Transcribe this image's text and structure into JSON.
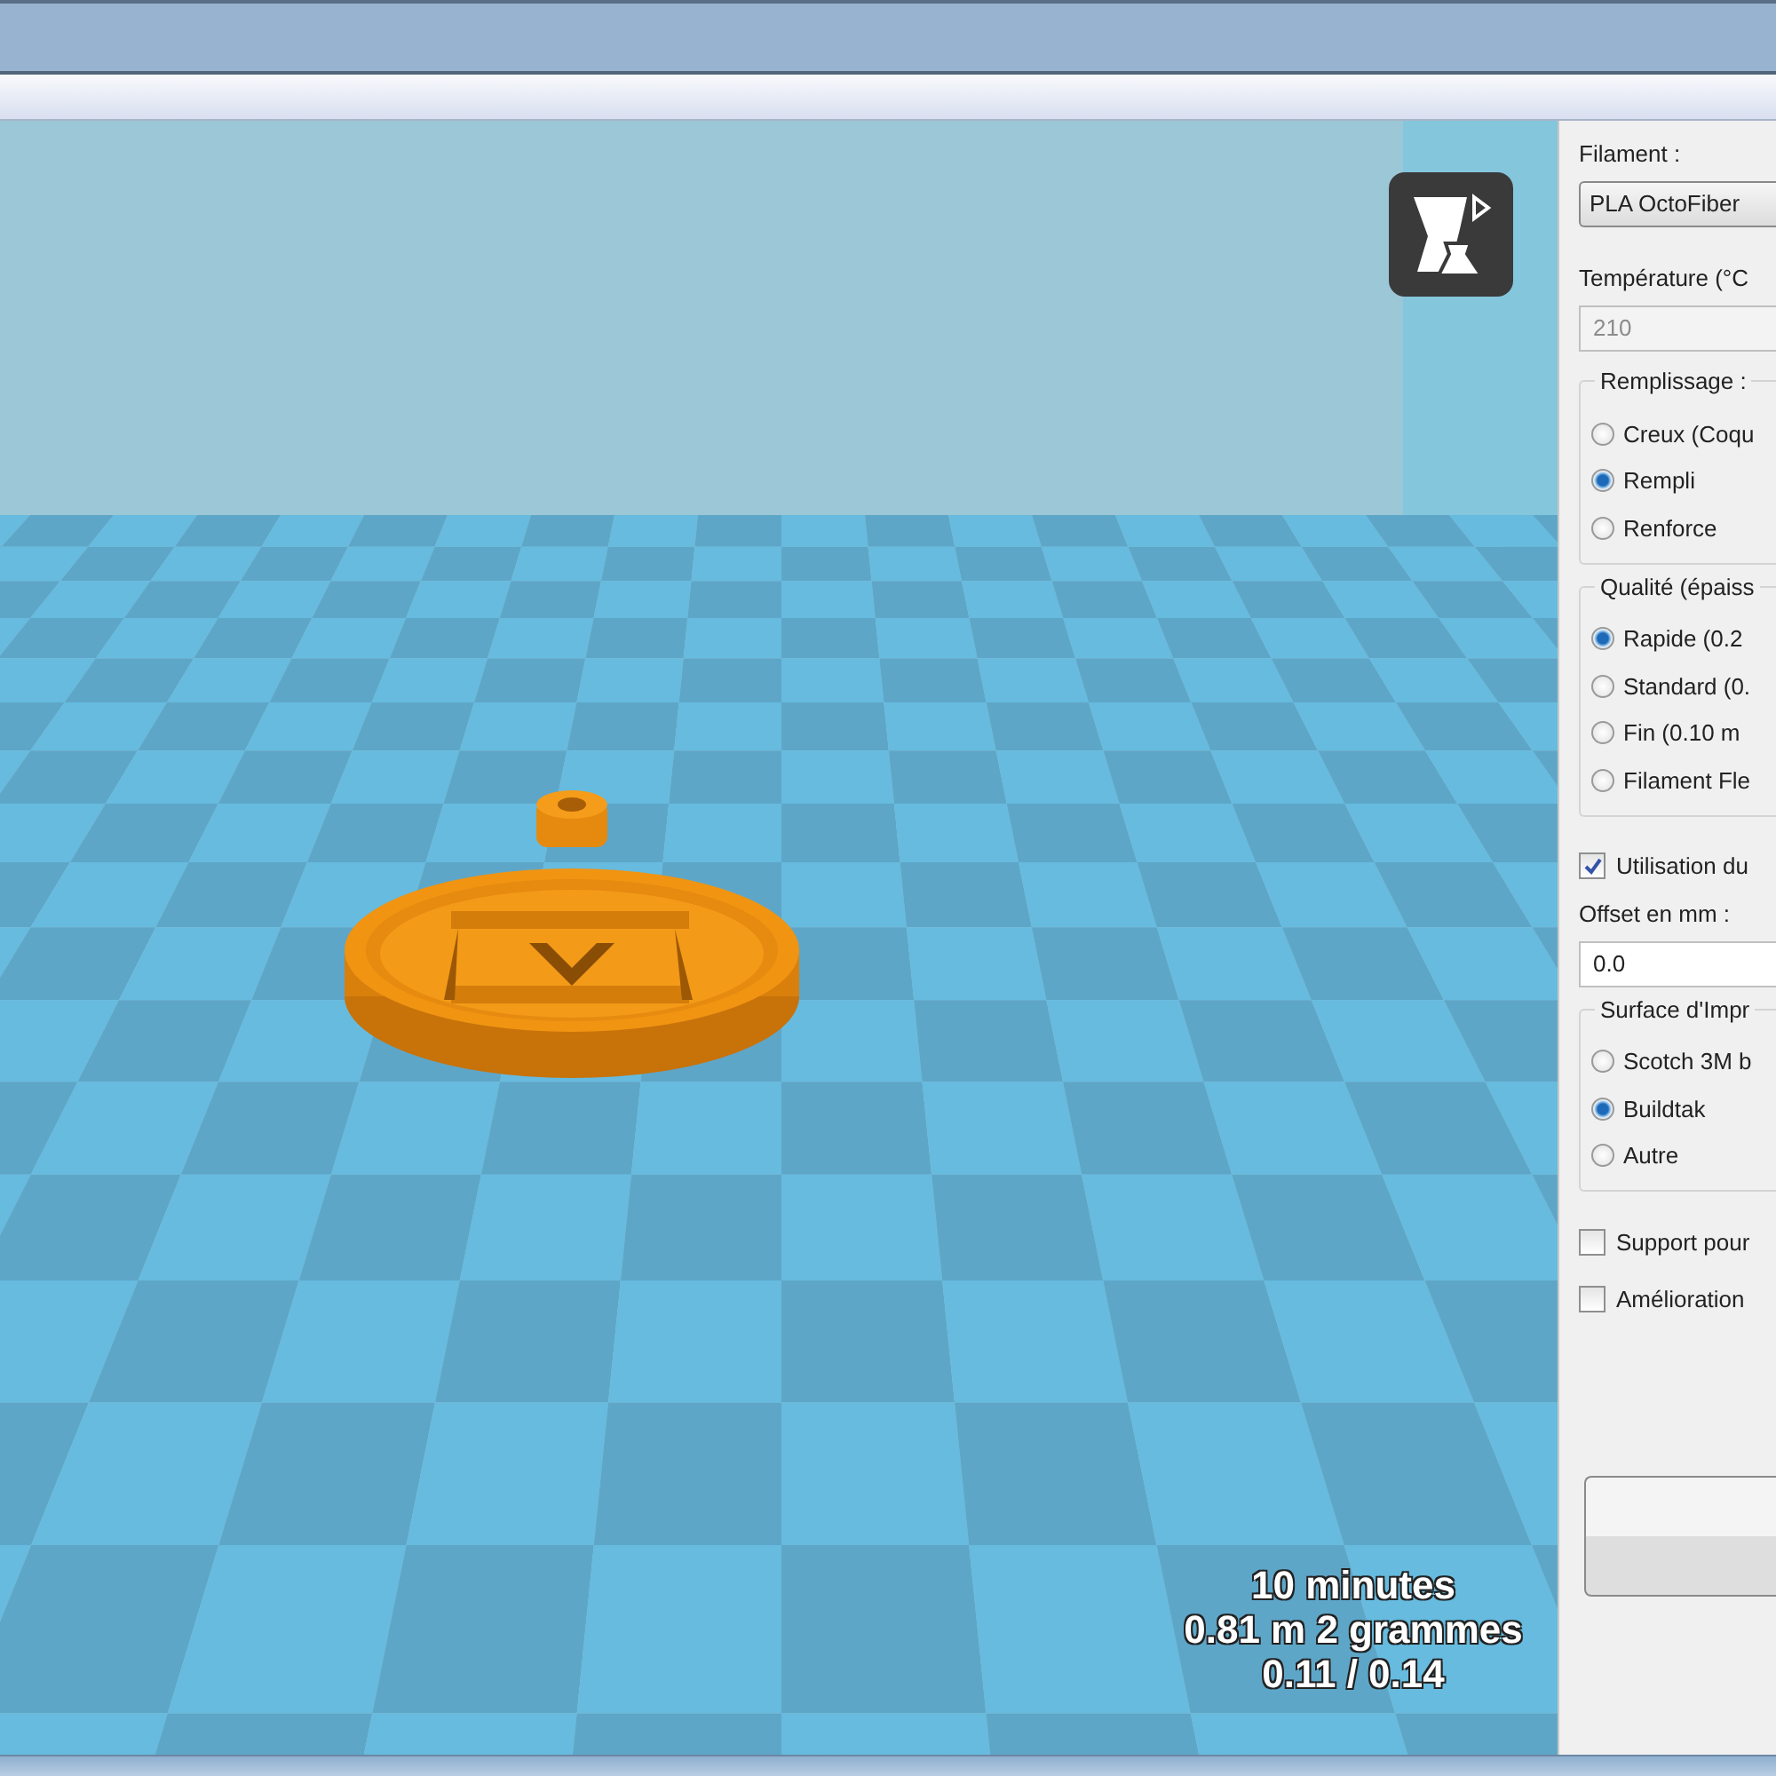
{
  "viewport": {
    "stats": [
      "10 minutes",
      "0.81 m 2 grammes",
      "0.11 / 0.14"
    ]
  },
  "panel": {
    "items": [
      {
        "kind": "label",
        "text": "Filament :"
      },
      {
        "kind": "dropdown",
        "value": "PLA OctoFiber"
      },
      {
        "kind": "label",
        "text": "Température (°C"
      },
      {
        "kind": "field",
        "value": "210",
        "disabled": true
      },
      {
        "kind": "group",
        "title": "Remplissage :",
        "options": [
          {
            "label": "Creux (Coqu",
            "selected": false
          },
          {
            "label": "Rempli",
            "selected": true
          },
          {
            "label": "Renforce",
            "selected": false
          }
        ]
      },
      {
        "kind": "group",
        "title": "Qualité (épaiss",
        "options": [
          {
            "label": "Rapide (0.2",
            "selected": true
          },
          {
            "label": "Standard (0.",
            "selected": false
          },
          {
            "label": "Fin (0.10 m",
            "selected": false
          },
          {
            "label": "Filament Fle",
            "selected": false
          }
        ]
      },
      {
        "kind": "checkbox",
        "label": "Utilisation du",
        "checked": true
      },
      {
        "kind": "label",
        "text": "Offset en mm :"
      },
      {
        "kind": "field",
        "value": "0.0",
        "disabled": false
      },
      {
        "kind": "group",
        "title": "Surface d'Impr",
        "options": [
          {
            "label": "Scotch 3M b",
            "selected": false
          },
          {
            "label": "Buildtak",
            "selected": true
          },
          {
            "label": "Autre",
            "selected": false
          }
        ]
      },
      {
        "kind": "checkbox",
        "label": "Support pour",
        "checked": false
      },
      {
        "kind": "checkbox",
        "label": "Amélioration",
        "checked": false
      }
    ]
  }
}
